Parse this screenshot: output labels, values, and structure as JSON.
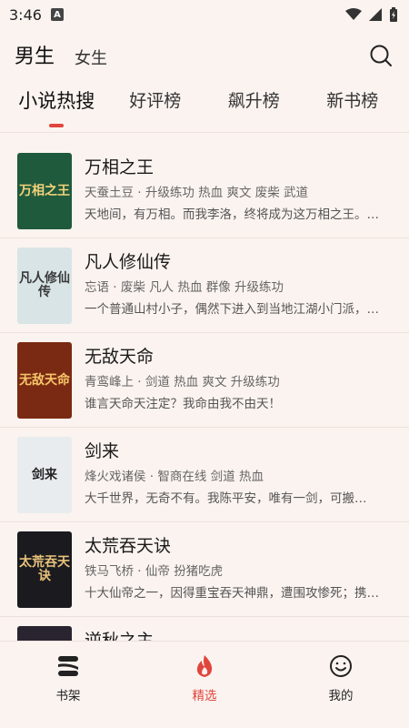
{
  "status": {
    "time": "3:46",
    "badge": "A"
  },
  "gender": {
    "male": "男生",
    "female": "女生"
  },
  "tabs": [
    {
      "label": "小说热搜",
      "active": true
    },
    {
      "label": "好评榜",
      "active": false
    },
    {
      "label": "飙升榜",
      "active": false
    },
    {
      "label": "新书榜",
      "active": false
    }
  ],
  "books": [
    {
      "title": "万相之王",
      "meta": "天蚕土豆 · 升级练功 热血 爽文 废柴 武道",
      "desc": "天地间，有万相。而我李洛，终将成为这万相之王。…",
      "cover_text": "万相之王",
      "cover_bg": "#1f5a3c",
      "cover_fg": "#f3d27a"
    },
    {
      "title": "凡人修仙传",
      "meta": "忘语 · 废柴 凡人 热血 群像 升级练功",
      "desc": "一个普通山村小子，偶然下进入到当地江湖小门派，…",
      "cover_text": "凡人修仙传",
      "cover_bg": "#d9e4e6",
      "cover_fg": "#3a3a3a"
    },
    {
      "title": "无敌天命",
      "meta": "青鸾峰上 · 剑道 热血 爽文 升级练功",
      "desc": "谁言天命天注定？我命由我不由天！",
      "cover_text": "无敌天命",
      "cover_bg": "#7a2a12",
      "cover_fg": "#f6c56a"
    },
    {
      "title": "剑来",
      "meta": "烽火戏诸侯 · 智商在线 剑道 热血",
      "desc": "大千世界，无奇不有。我陈平安，唯有一剑，可搬…",
      "cover_text": "剑来",
      "cover_bg": "#e8ecef",
      "cover_fg": "#222222"
    },
    {
      "title": "太荒吞天诀",
      "meta": "铁马飞桥 · 仙帝 扮猪吃虎",
      "desc": "十大仙帝之一，因得重宝吞天神鼎，遭围攻惨死；携…",
      "cover_text": "太荒吞天诀",
      "cover_bg": "#1a1a1f",
      "cover_fg": "#e8c27a"
    },
    {
      "title": "逆秋之主",
      "meta": "",
      "desc": "",
      "cover_text": "",
      "cover_bg": "#2a2430",
      "cover_fg": "#cccccc"
    }
  ],
  "bottom_nav": [
    {
      "label": "书架",
      "icon": "bookshelf-icon",
      "active": false
    },
    {
      "label": "精选",
      "icon": "flame-icon",
      "active": true
    },
    {
      "label": "我的",
      "icon": "smiley-icon",
      "active": false
    }
  ],
  "colors": {
    "accent": "#e0463d",
    "background": "#fbf3ef"
  }
}
